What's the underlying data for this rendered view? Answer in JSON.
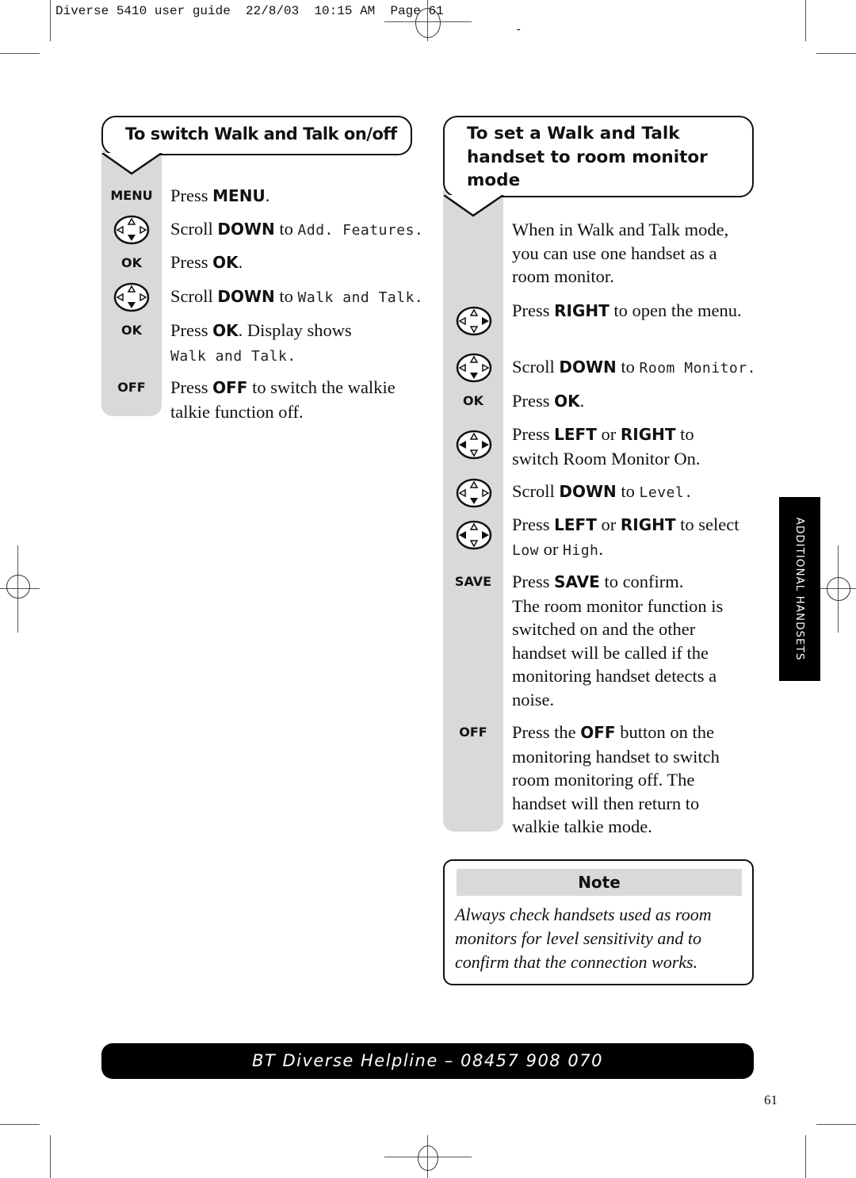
{
  "slug": "Diverse 5410 user guide  22/8/03  10:15 AM  Page 61",
  "left_section": {
    "title": "To switch Walk and Talk on/off",
    "steps": [
      {
        "key": "MENU",
        "pre": "Press ",
        "bold": "MENU",
        "post": ".",
        "lcd": ""
      },
      {
        "key_icon": "nav-down",
        "pre": "Scroll ",
        "bold": "DOWN",
        "post": " to ",
        "lcd": "Add. Features."
      },
      {
        "key": "OK",
        "pre": "Press ",
        "bold": "OK",
        "post": ".",
        "lcd": ""
      },
      {
        "key_icon": "nav-down",
        "pre": "Scroll ",
        "bold": "DOWN",
        "post": " to ",
        "lcd": "Walk and Talk."
      },
      {
        "key": "OK",
        "pre": "Press ",
        "bold": "OK",
        "post": ".  Display shows",
        "lcd": "Walk and Talk."
      },
      {
        "key": "OFF",
        "pre": "Press ",
        "bold": "OFF",
        "post": " to switch the walkie talkie function off.",
        "lcd": ""
      }
    ]
  },
  "right_section": {
    "title": "To set a Walk and Talk handset to room monitor mode",
    "intro": "When in Walk and Talk mode, you can use one handset as a room monitor.",
    "steps": [
      {
        "key_icon": "nav-right",
        "pre": "Press ",
        "bold": "RIGHT",
        "post": " to open the menu."
      },
      {
        "key_icon": "nav-down",
        "pre": "Scroll ",
        "bold": "DOWN",
        "post": " to ",
        "lcd": "Room Monitor."
      },
      {
        "key": "OK",
        "pre": "Press ",
        "bold": "OK",
        "post": "."
      },
      {
        "key_icon": "nav-left-right",
        "pre": "Press ",
        "bold": "LEFT",
        "mid": " or ",
        "bold2": "RIGHT",
        "post": " to switch Room Monitor On."
      },
      {
        "key_icon": "nav-down",
        "pre": "Scroll ",
        "bold": "DOWN",
        "post": " to ",
        "lcd": "Level."
      },
      {
        "key_icon": "nav-left-right",
        "pre": "Press ",
        "bold": "LEFT",
        "mid": " or ",
        "bold2": "RIGHT",
        "post": " to select",
        "lcd_a": "Low",
        "or": " or ",
        "lcd_b": "High",
        "end": "."
      },
      {
        "key": "SAVE",
        "pre": "Press ",
        "bold": "SAVE",
        "post": " to confirm.",
        "extra": "The room monitor function is switched on and the other handset will be called if the monitoring handset detects a noise."
      },
      {
        "key": "OFF",
        "pre": "Press the ",
        "bold": "OFF",
        "post": " button on the monitoring handset to switch room monitoring off. The handset will then return to walkie talkie mode."
      }
    ]
  },
  "note": {
    "title": "Note",
    "text": "Always check handsets used as room monitors for level sensitivity and to confirm that the connection works."
  },
  "side_tab": "ADDITIONAL HANDSETS",
  "helpline": "BT Diverse Helpline – 08457 908 070",
  "page_number": "61"
}
